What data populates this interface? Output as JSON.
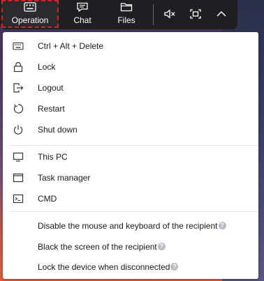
{
  "toolbar": {
    "tabs": [
      {
        "label": "Operation",
        "icon": "keyboard-icon"
      },
      {
        "label": "Chat",
        "icon": "chat-icon"
      },
      {
        "label": "Files",
        "icon": "folder-icon"
      }
    ],
    "controls": [
      {
        "icon": "mute-icon"
      },
      {
        "icon": "fullscreen-icon"
      },
      {
        "icon": "chevron-up-icon"
      }
    ]
  },
  "menu": {
    "power_items": [
      {
        "label": "Ctrl + Alt + Delete",
        "icon": "keyboard-icon"
      },
      {
        "label": "Lock",
        "icon": "lock-icon"
      },
      {
        "label": "Logout",
        "icon": "logout-icon"
      },
      {
        "label": "Restart",
        "icon": "restart-icon"
      },
      {
        "label": "Shut down",
        "icon": "power-icon"
      }
    ],
    "app_items": [
      {
        "label": "This PC",
        "icon": "monitor-icon"
      },
      {
        "label": "Task manager",
        "icon": "window-icon"
      },
      {
        "label": "CMD",
        "icon": "terminal-icon"
      }
    ],
    "options": [
      {
        "label": "Disable the mouse and keyboard of the recipient"
      },
      {
        "label": "Black the screen of the recipient"
      },
      {
        "label": "Lock the device when disconnected"
      }
    ]
  },
  "colors": {
    "accent_outline": "#e02020",
    "toolbar_bg": "#1f1f22"
  }
}
